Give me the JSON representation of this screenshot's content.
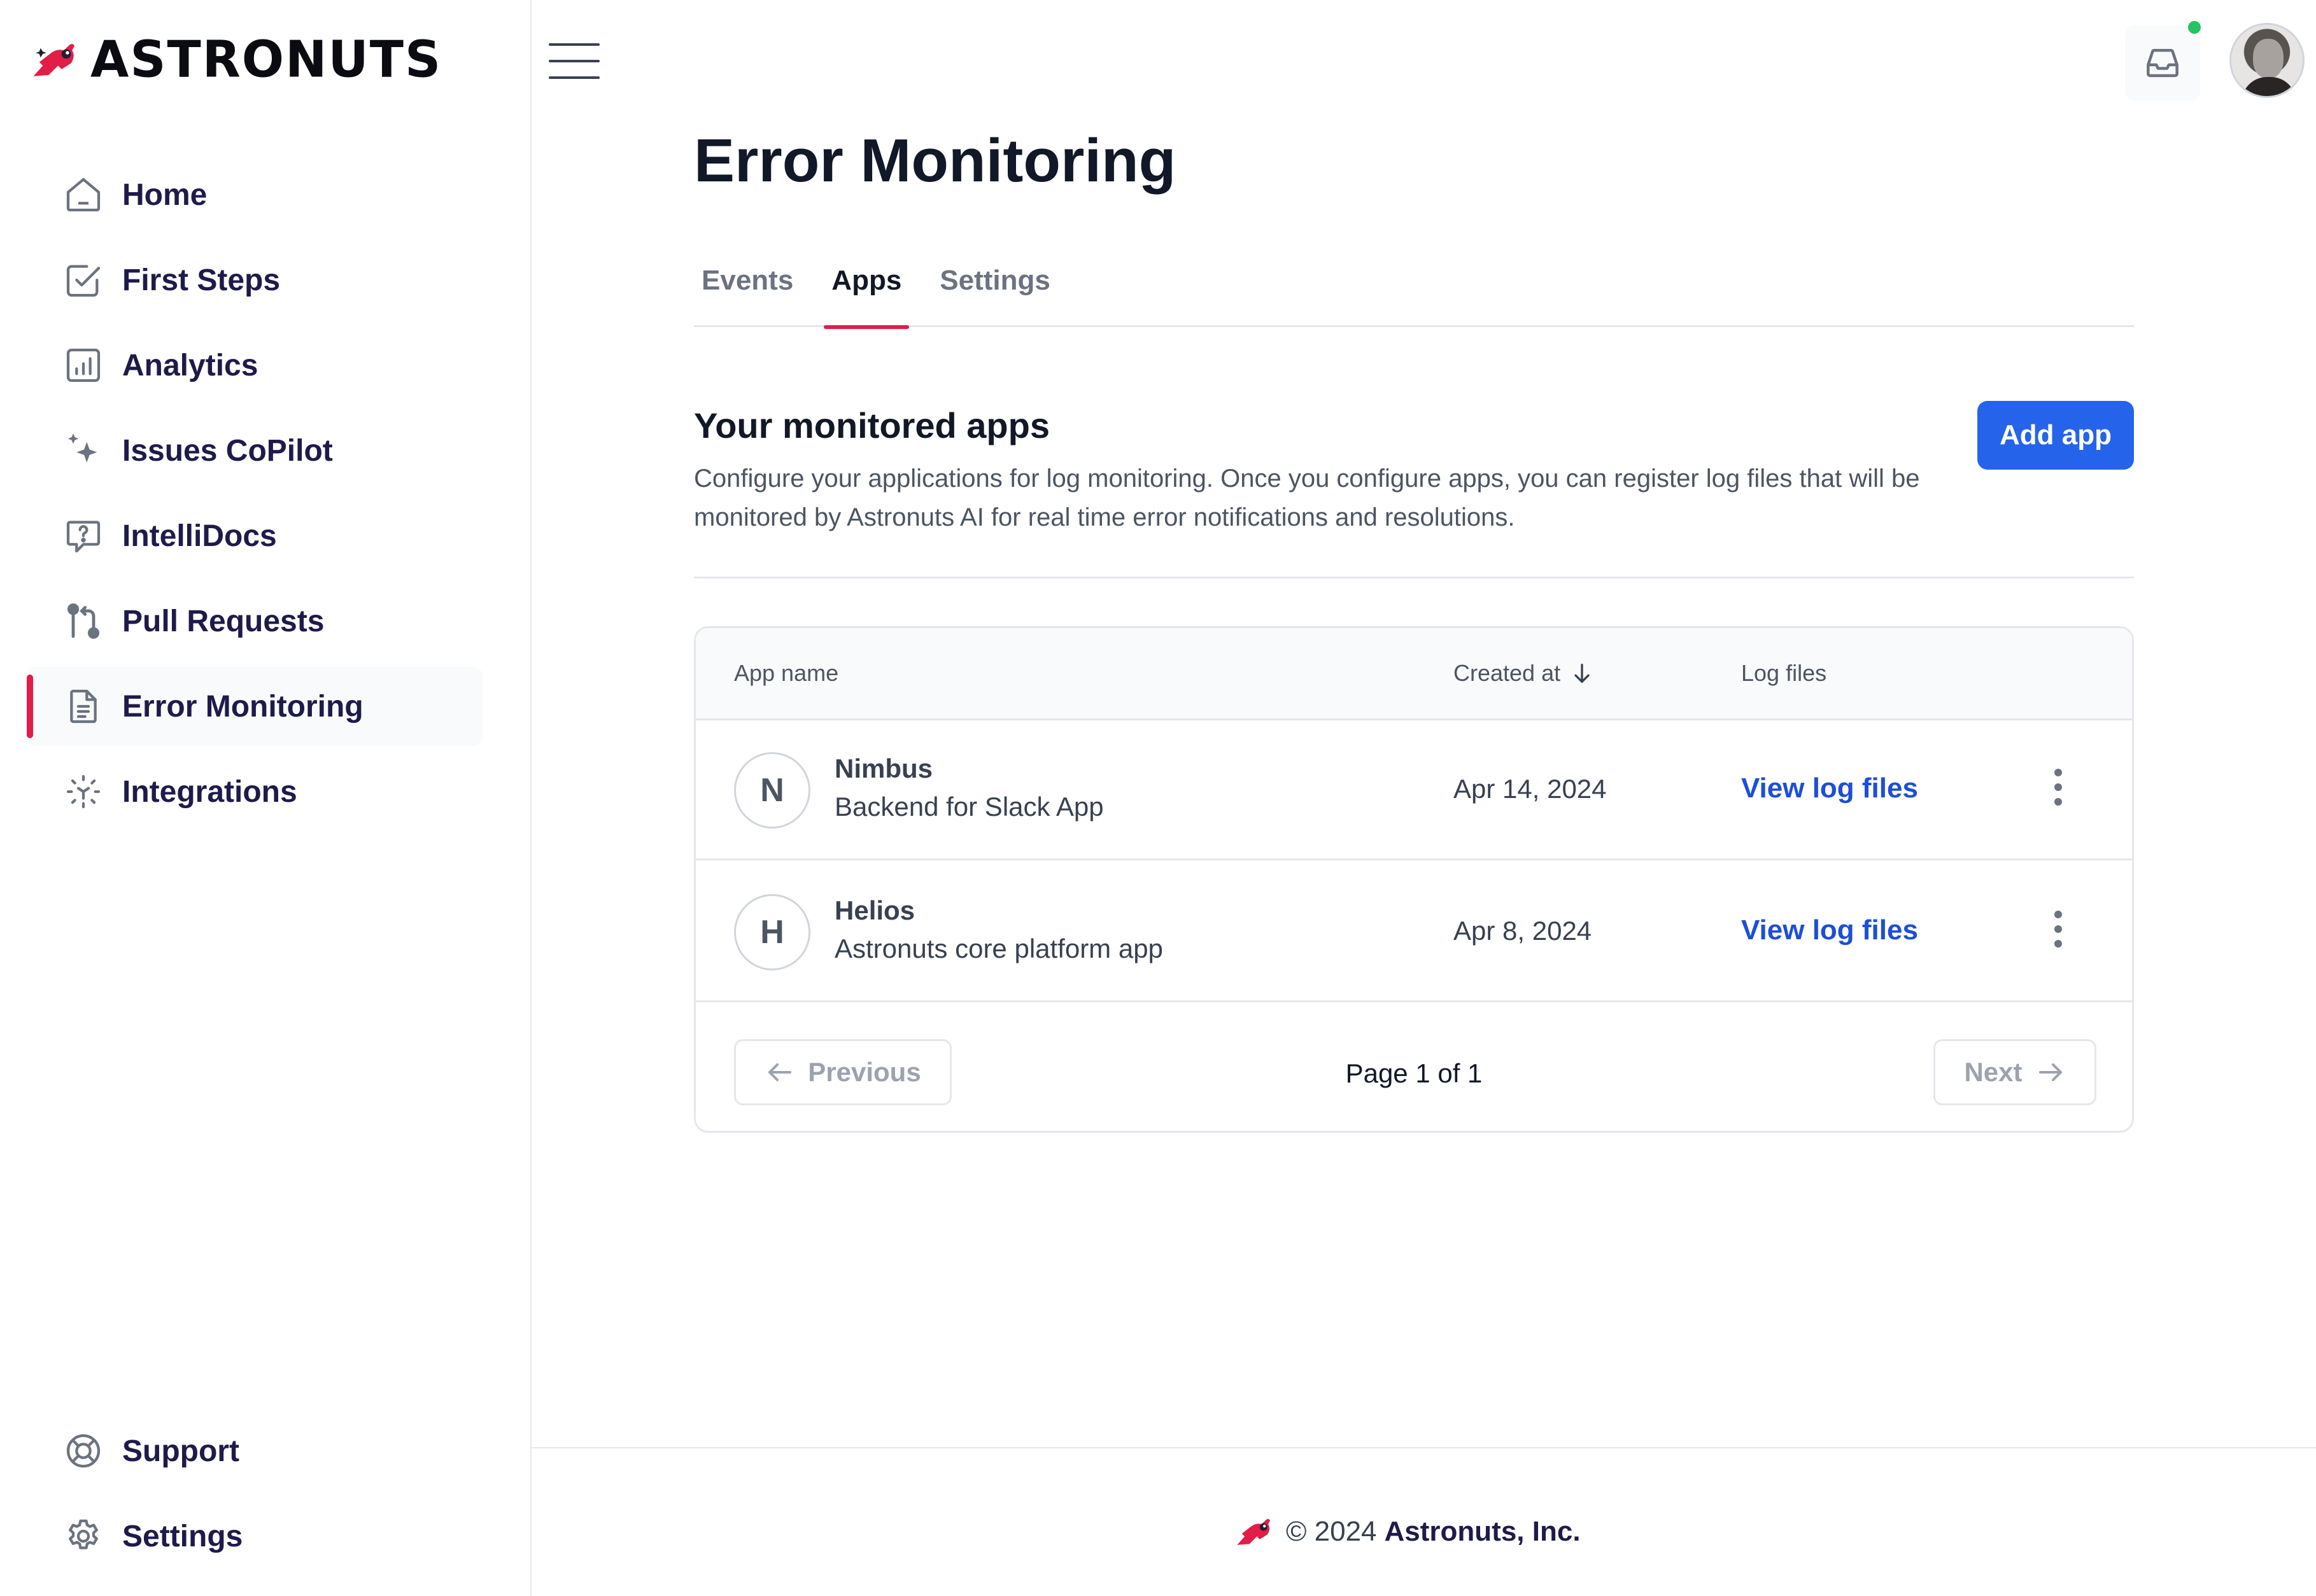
{
  "brand": {
    "name": "ASTRONUTS",
    "accent": "#e11d48",
    "primary": "#2563eb"
  },
  "sidebar": {
    "items": [
      {
        "label": "Home",
        "icon": "home-icon"
      },
      {
        "label": "First Steps",
        "icon": "checkbox-icon"
      },
      {
        "label": "Analytics",
        "icon": "bar-chart-icon"
      },
      {
        "label": "Issues CoPilot",
        "icon": "sparkles-icon"
      },
      {
        "label": "IntelliDocs",
        "icon": "question-chat-icon"
      },
      {
        "label": "Pull Requests",
        "icon": "git-pull-request-icon"
      },
      {
        "label": "Error Monitoring",
        "icon": "document-icon",
        "active": true
      },
      {
        "label": "Integrations",
        "icon": "integrations-icon"
      }
    ],
    "bottom": [
      {
        "label": "Support",
        "icon": "lifebuoy-icon"
      },
      {
        "label": "Settings",
        "icon": "gear-icon"
      }
    ]
  },
  "header": {
    "notification_status": "online"
  },
  "page": {
    "title": "Error Monitoring",
    "tabs": [
      "Events",
      "Apps",
      "Settings"
    ],
    "active_tab": "Apps",
    "section_title": "Your monitored apps",
    "section_desc": "Configure your applications for log monitoring. Once you configure apps, you can register log files that will be monitored by Astronuts AI for real time error notifications and resolutions.",
    "add_button": "Add app"
  },
  "table": {
    "headers": {
      "name": "App name",
      "created": "Created at",
      "logs": "Log files"
    },
    "rows": [
      {
        "initial": "N",
        "name": "Nimbus",
        "desc": "Backend for Slack App",
        "created": "Apr 14, 2024",
        "link": "View log files"
      },
      {
        "initial": "H",
        "name": "Helios",
        "desc": "Astronuts core platform app",
        "created": "Apr 8, 2024",
        "link": "View log files"
      }
    ],
    "pagination": {
      "prev": "Previous",
      "next": "Next",
      "page_text": "Page 1 of 1"
    }
  },
  "footer": {
    "copyright": "© 2024",
    "company": "Astronuts, Inc."
  }
}
